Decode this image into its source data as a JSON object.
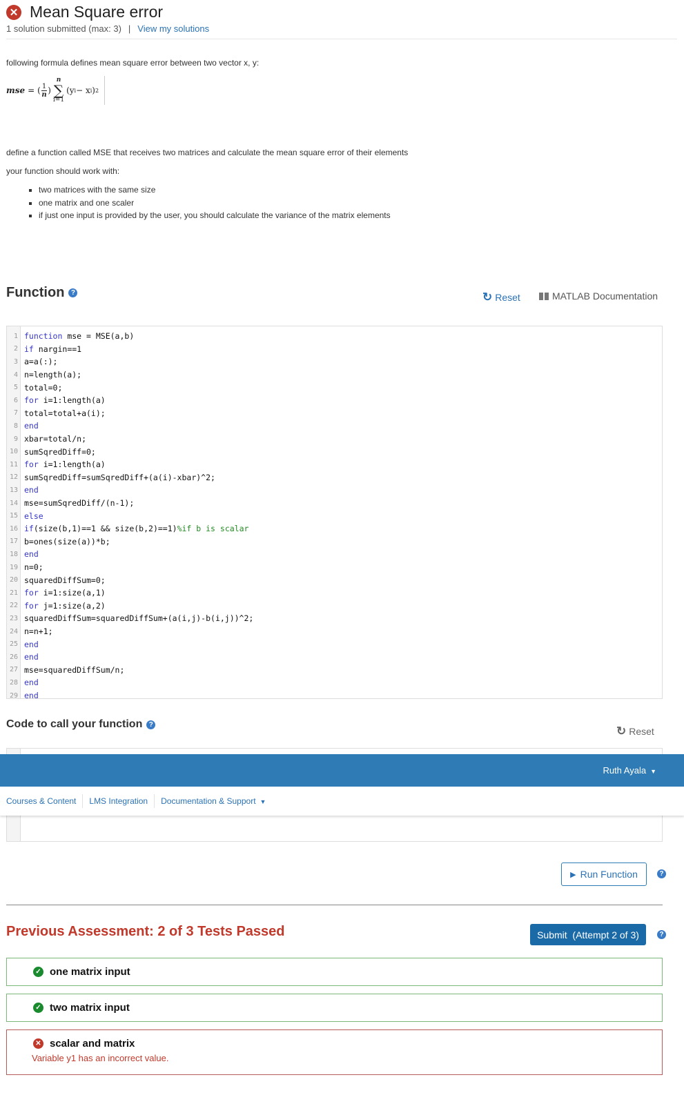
{
  "problem": {
    "title": "Mean Square error",
    "status": "failed",
    "submissions_text": "1 solution submitted (max: 3)",
    "separator": "|",
    "view_solutions_link": "View my solutions"
  },
  "description": {
    "intro": "following formula defines mean square error between two vector x, y:",
    "formula": {
      "lhs": "mse",
      "equals": "=",
      "frac_num": "1",
      "frac_den": "n",
      "sigma": "∑",
      "sigma_upper": "n",
      "sigma_lower": "i=1",
      "body": "(y",
      "sub_i": "i",
      "minus": " − x",
      "sub_i2": "i",
      "close": ")",
      "power": "2"
    },
    "task": "define a function called MSE that receives two matrices and calculate the mean square error of their elements",
    "work_with": "your function should work with:",
    "requirements": [
      "two matrices with the same size",
      "one matrix and one scaler",
      "if just one input is provided by the user, you should calculate the variance of the matrix elements"
    ]
  },
  "function_section": {
    "heading": "Function",
    "help_icon": "?",
    "reset_label": "Reset",
    "doc_label": "MATLAB Documentation",
    "code_lines": [
      [
        {
          "t": "function",
          "k": "kw"
        },
        {
          "t": " mse = MSE(a,b)"
        }
      ],
      [
        {
          "t": "if",
          "k": "kw"
        },
        {
          "t": " nargin==1"
        }
      ],
      [
        {
          "t": "a=a(:);"
        }
      ],
      [
        {
          "t": "n=length(a);"
        }
      ],
      [
        {
          "t": "total=0;"
        }
      ],
      [
        {
          "t": "for",
          "k": "kw"
        },
        {
          "t": " i=1:length(a)"
        }
      ],
      [
        {
          "t": "total=total+a(i);"
        }
      ],
      [
        {
          "t": "end",
          "k": "kw"
        }
      ],
      [
        {
          "t": "xbar=total/n;"
        }
      ],
      [
        {
          "t": "sumSqredDiff=0;"
        }
      ],
      [
        {
          "t": "for",
          "k": "kw"
        },
        {
          "t": " i=1:length(a)"
        }
      ],
      [
        {
          "t": "sumSqredDiff=sumSqredDiff+(a(i)-xbar)^2;"
        }
      ],
      [
        {
          "t": "end",
          "k": "kw"
        }
      ],
      [
        {
          "t": "mse=sumSqredDiff/(n-1);"
        }
      ],
      [
        {
          "t": "else",
          "k": "kw"
        }
      ],
      [
        {
          "t": "if",
          "k": "kw"
        },
        {
          "t": "(size(b,1)==1 && size(b,2)==1)"
        },
        {
          "t": "%if b is scalar",
          "k": "cm"
        }
      ],
      [
        {
          "t": "b=ones(size(a))*b;"
        }
      ],
      [
        {
          "t": "end",
          "k": "kw"
        }
      ],
      [
        {
          "t": "n=0;"
        }
      ],
      [
        {
          "t": "squaredDiffSum=0;"
        }
      ],
      [
        {
          "t": "for",
          "k": "kw"
        },
        {
          "t": " i=1:size(a,1)"
        }
      ],
      [
        {
          "t": "for",
          "k": "kw"
        },
        {
          "t": " j=1:size(a,2)"
        }
      ],
      [
        {
          "t": "squaredDiffSum=squaredDiffSum+(a(i,j)-b(i,j))^2;"
        }
      ],
      [
        {
          "t": "n=n+1;"
        }
      ],
      [
        {
          "t": "end",
          "k": "kw"
        }
      ],
      [
        {
          "t": "end",
          "k": "kw"
        }
      ],
      [
        {
          "t": "mse=squaredDiffSum/n;"
        }
      ],
      [
        {
          "t": "end",
          "k": "kw"
        }
      ],
      [
        {
          "t": "end",
          "k": "kw"
        }
      ]
    ]
  },
  "call_section": {
    "heading": "Code to call your function",
    "help_icon": "?",
    "reset_label": "Reset"
  },
  "topbar": {
    "user_name": "Ruth Ayala",
    "caret": "▼"
  },
  "subnav": {
    "items": [
      "Courses & Content",
      "LMS Integration",
      "Documentation & Support"
    ],
    "caret": "▼"
  },
  "actions": {
    "run_label": "Run Function",
    "run_icon": "▶",
    "submit_label": "Submit  (Attempt 2 of 3)",
    "help_icon": "?"
  },
  "assessment": {
    "heading": "Previous Assessment: 2 of 3 Tests Passed",
    "tests": [
      {
        "name": "one matrix input",
        "passed": true,
        "icon": "✓"
      },
      {
        "name": "two matrix input",
        "passed": true,
        "icon": "✓"
      },
      {
        "name": "scalar and matrix",
        "passed": false,
        "icon": "✕",
        "message": "Variable y1 has an incorrect value."
      }
    ]
  },
  "colors": {
    "accent": "#2e7bb5",
    "link": "#2a72b5",
    "fail": "#c0392b",
    "pass": "#1a8a2e",
    "keyword": "#3636c8",
    "comment": "#228b22"
  }
}
